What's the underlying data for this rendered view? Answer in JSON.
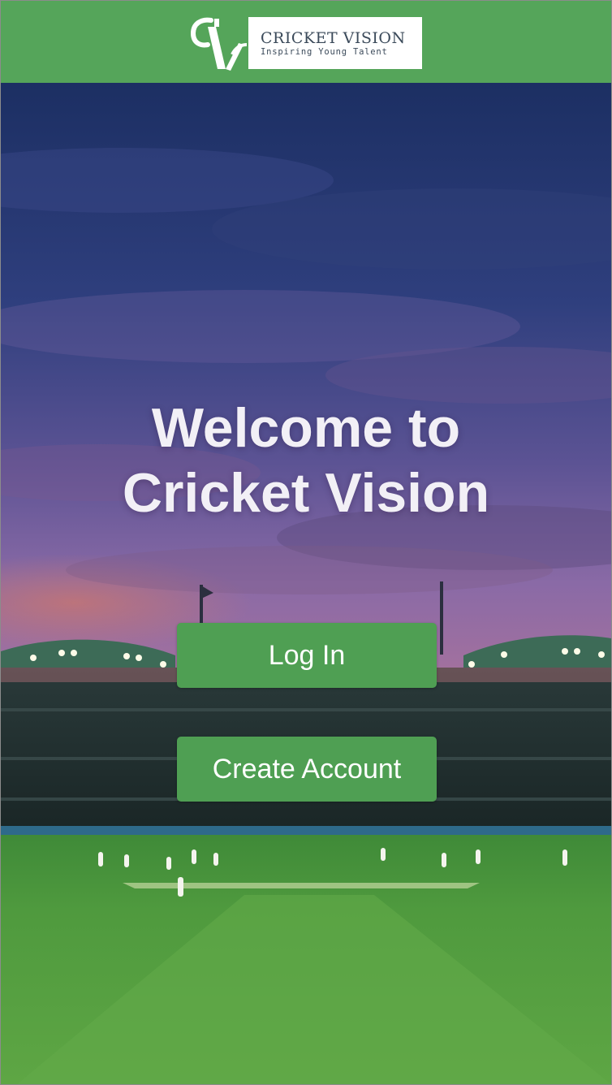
{
  "brand": {
    "logo_monogram": "CV",
    "logo_title": "CRICKET VISION",
    "logo_tagline": "Inspiring Young Talent"
  },
  "hero": {
    "background": "cricket-stadium-at-dusk",
    "welcome_line1": "Welcome to",
    "welcome_line2": "Cricket Vision"
  },
  "actions": {
    "login_label": "Log In",
    "create_account_label": "Create Account"
  },
  "colors": {
    "header_green": "#55a55a",
    "button_green": "#4f9f53",
    "button_text": "#ffffff",
    "heading_text": "#f2f0f6"
  }
}
